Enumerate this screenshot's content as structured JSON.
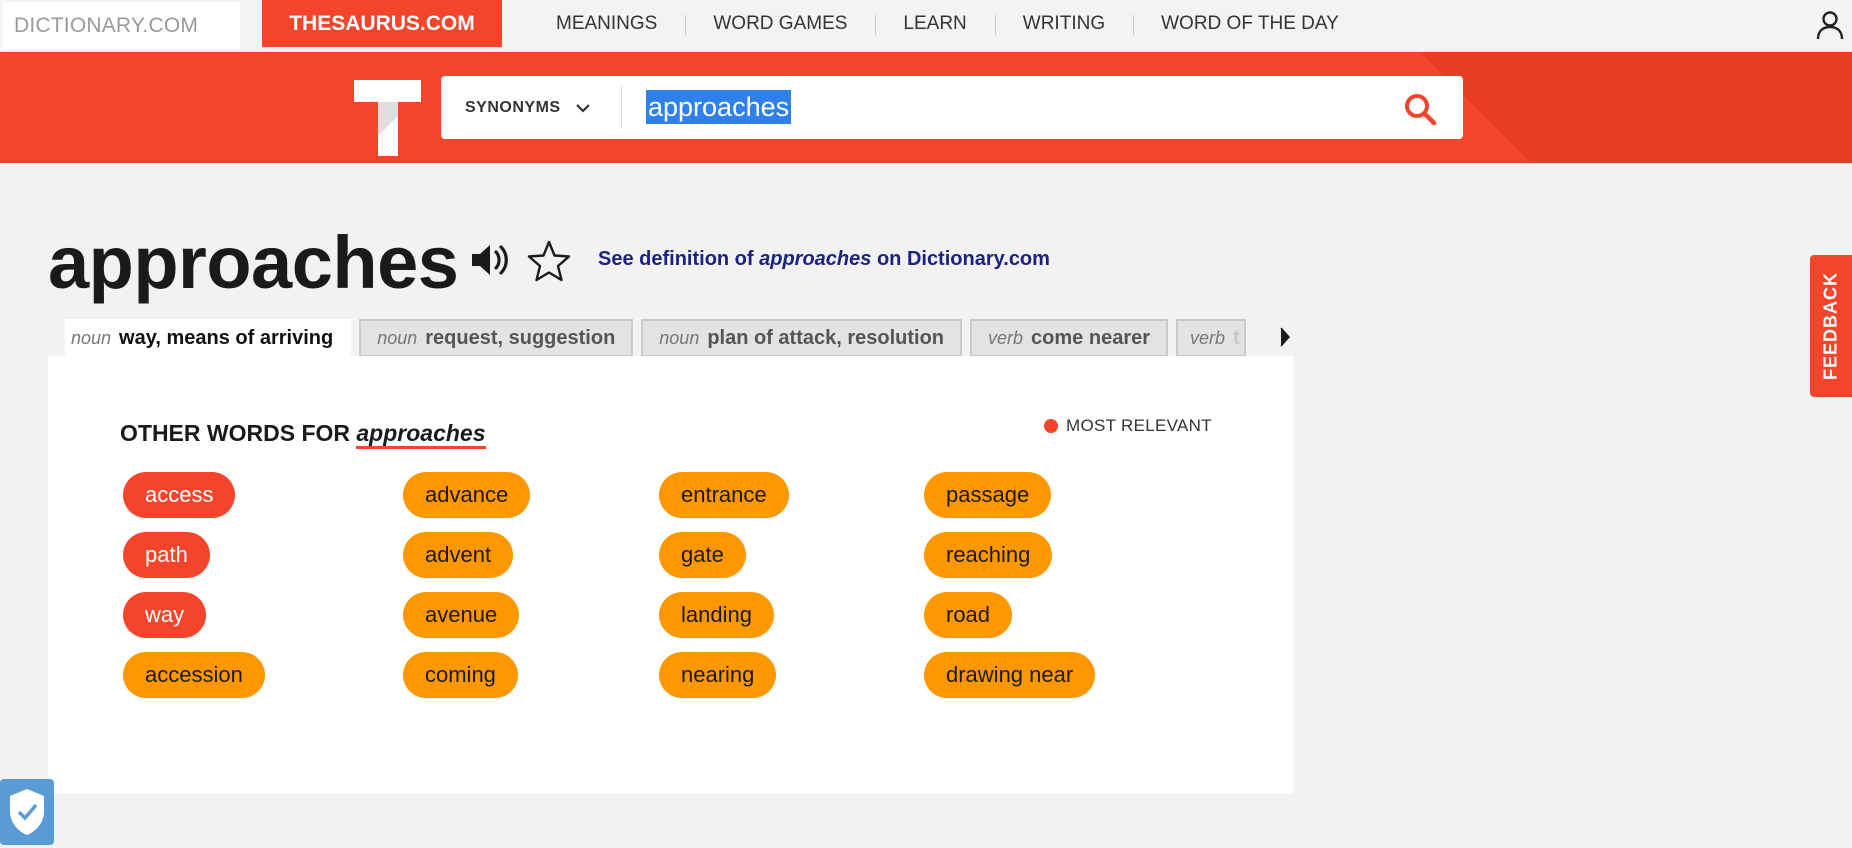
{
  "topnav": {
    "dictionary_tab": "DICTIONARY.COM",
    "thesaurus_tab": "THESAURUS.COM",
    "links": [
      "MEANINGS",
      "WORD GAMES",
      "LEARN",
      "WRITING",
      "WORD OF THE DAY"
    ],
    "user_icon": "user-icon"
  },
  "search": {
    "mode_label": "SYNONYMS",
    "query": "approaches",
    "search_icon": "search-icon"
  },
  "entry": {
    "headword": "approaches",
    "see_definition_prefix": "See definition of ",
    "see_definition_word": "approaches",
    "see_definition_suffix": " on Dictionary.com"
  },
  "senses": [
    {
      "pos": "noun",
      "label": "way, means of arriving"
    },
    {
      "pos": "noun",
      "label": "request, suggestion"
    },
    {
      "pos": "noun",
      "label": "plan of attack, resolution"
    },
    {
      "pos": "verb",
      "label": "come nearer"
    },
    {
      "pos": "verb",
      "label": "t"
    }
  ],
  "results": {
    "title_prefix": "OTHER WORDS FOR ",
    "title_word": "approaches",
    "legend_label": "MOST RELEVANT",
    "words": [
      "access",
      "path",
      "way",
      "accession",
      "advance",
      "advent",
      "avenue",
      "coming",
      "entrance",
      "gate",
      "landing",
      "nearing",
      "passage",
      "reaching",
      "road",
      "drawing near"
    ]
  },
  "feedback_label": "FEEDBACK",
  "colors": {
    "brand": "#f5442c",
    "most_relevant": "#f5442c",
    "relevant": "#ff9800",
    "link": "#1a237e"
  }
}
